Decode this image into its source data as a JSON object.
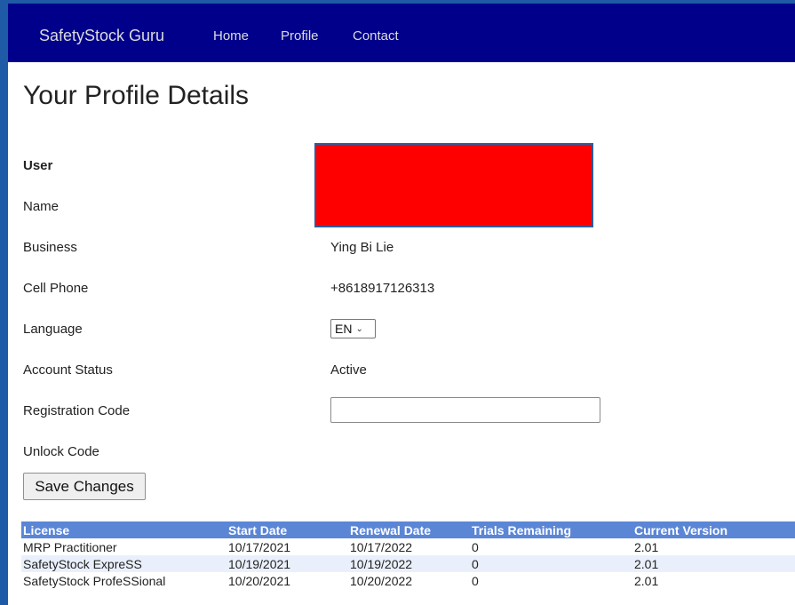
{
  "navbar": {
    "brand": "SafetyStock Guru",
    "links": [
      "Home",
      "Profile",
      "Contact"
    ]
  },
  "page_title": "Your Profile Details",
  "profile": {
    "user_label": "User",
    "name_label": "Name",
    "business_label": "Business",
    "business_value": "Ying Bi Lie",
    "cell_label": "Cell Phone",
    "cell_value": "+8618917126313",
    "language_label": "Language",
    "language_value": "EN",
    "status_label": "Account Status",
    "status_value": "Active",
    "registration_label": "Registration Code",
    "registration_value": "",
    "unlock_label": "Unlock Code"
  },
  "save_button": "Save Changes",
  "licenses": {
    "headers": [
      "License",
      "Start Date",
      "Renewal Date",
      "Trials Remaining",
      "Current Version"
    ],
    "rows": [
      [
        "MRP Practitioner",
        "10/17/2021",
        "10/17/2022",
        "0",
        "2.01"
      ],
      [
        "SafetyStock ExpreSS",
        "10/19/2021",
        "10/19/2022",
        "0",
        "2.01"
      ],
      [
        "SafetyStock ProfeSSional",
        "10/20/2021",
        "10/20/2022",
        "0",
        "2.01"
      ]
    ]
  },
  "colors": {
    "navbar_bg": "#00008b",
    "frame": "#1f5aa6",
    "table_header_bg": "#5b86d6",
    "redaction": "#ff0000"
  }
}
